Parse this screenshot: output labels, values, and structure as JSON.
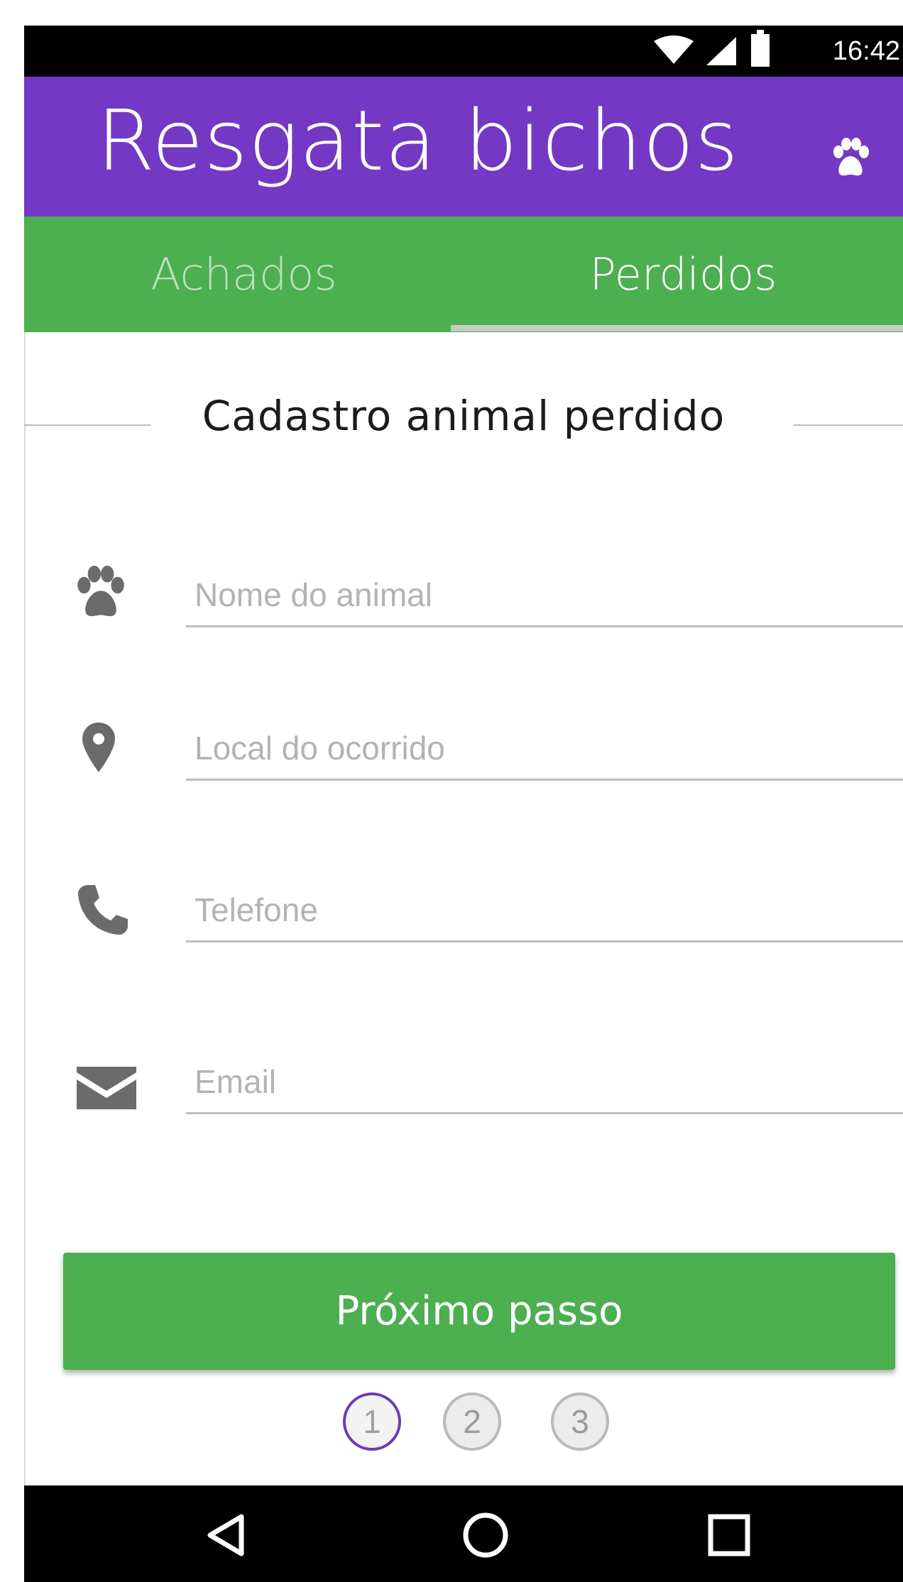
{
  "status_bar": {
    "time": "16:42"
  },
  "header": {
    "title": "Resgata bichos"
  },
  "tabs": [
    {
      "label": "Achados",
      "selected": false
    },
    {
      "label": "Perdidos",
      "selected": true
    }
  ],
  "form": {
    "title": "Cadastro animal perdido",
    "fields": [
      {
        "icon": "paw-icon",
        "placeholder": "Nome do animal",
        "value": ""
      },
      {
        "icon": "location-pin-icon",
        "placeholder": "Local do ocorrido",
        "value": ""
      },
      {
        "icon": "phone-icon",
        "placeholder": "Telefone",
        "value": ""
      },
      {
        "icon": "email-icon",
        "placeholder": "Email",
        "value": ""
      }
    ],
    "next_button_label": "Próximo passo"
  },
  "stepper": {
    "steps": [
      "1",
      "2",
      "3"
    ],
    "current": 1
  },
  "colors": {
    "header": "#7338c4",
    "tab_bar": "#4caf50",
    "button": "#4caf50",
    "active_step": "#6a3cbc"
  }
}
